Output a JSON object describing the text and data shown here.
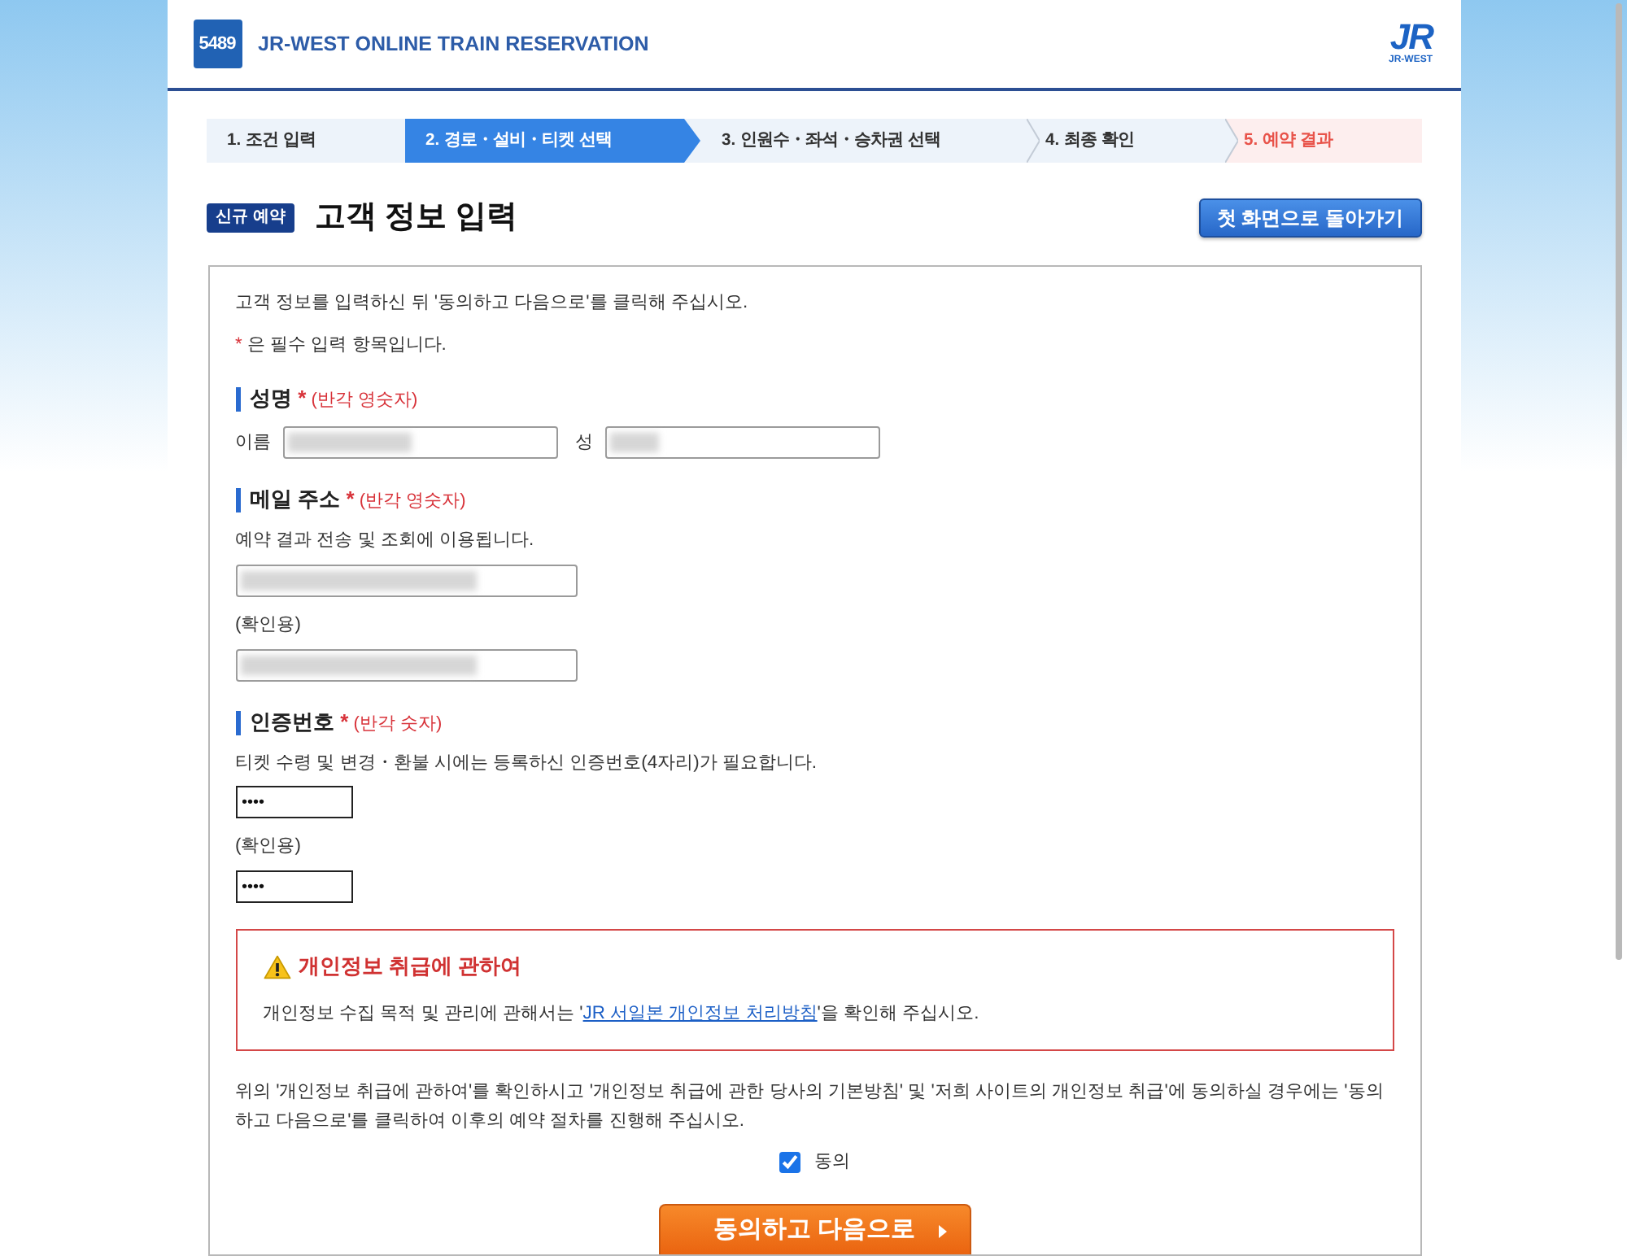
{
  "header": {
    "logo_badge": "5489",
    "title": "JR-WEST ONLINE TRAIN RESERVATION",
    "brand_logo": "JR",
    "brand_caption": "JR-WEST"
  },
  "steps": [
    {
      "label": "1. 조건 입력",
      "kind": "step",
      "selected": false
    },
    {
      "label": "2. 경로・설비・티켓 선택",
      "kind": "step",
      "selected": true
    },
    {
      "label": "3. 인원수・좌석・승차권 선택",
      "kind": "step",
      "selected": false
    },
    {
      "label": "4. 최종 확인",
      "kind": "step",
      "selected": false
    },
    {
      "label": "5. 예약 결과",
      "kind": "result",
      "selected": false
    }
  ],
  "page": {
    "badge": "신규 예약",
    "title": "고객 정보 입력",
    "back_button": "첫 화면으로 돌아가기"
  },
  "form": {
    "intro": "고객 정보를 입력하신 뒤 '동의하고 다음으로'를 클릭해 주십시오.",
    "required_legend": {
      "mark": "*",
      "text": "은 필수 입력 항목입니다."
    },
    "sections": [
      {
        "kind": "name",
        "title": "성명",
        "required_mark": "*",
        "note": "(반각 영숫자)",
        "fields": [
          {
            "label": "이름",
            "redacted": true
          },
          {
            "label": "성",
            "redacted": true
          }
        ]
      },
      {
        "kind": "email",
        "title": "메일 주소",
        "required_mark": "*",
        "note": "(반각 영숫자)",
        "description": "예약 결과 전송 및 조회에 이용됩니다.",
        "fields": [
          {
            "redacted": true
          },
          {
            "label": "(확인용)",
            "redacted": true
          }
        ]
      },
      {
        "kind": "pin",
        "title": "인증번호",
        "required_mark": "*",
        "note": "(반각 숫자)",
        "description": "티켓 수령 및 변경・환불 시에는 등록하신 인증번호(4자리)가 필요합니다.",
        "fields": [
          {
            "value": "••••"
          },
          {
            "label": "(확인용)",
            "value": "••••"
          }
        ]
      }
    ],
    "privacy_notice": {
      "title": "개인정보 취급에 관하여",
      "text_before": "개인정보 수집 목적 및 관리에 관해서는 '",
      "link": "JR 서일본 개인정보 처리방침",
      "text_after": "'을 확인해 주십시오."
    },
    "consent_text": "위의 '개인정보 취급에 관하여'를 확인하시고 '개인정보 취급에 관한 당사의 기본방침' 및 '저희 사이트의 개인정보 취급'에 동의하실 경우에는 '동의하고 다음으로'를 클릭하여 이후의 예약 절차를 진행해 주십시오.",
    "agree": {
      "label": "동의",
      "checked": true
    },
    "submit_button": "동의하고 다음으로"
  }
}
